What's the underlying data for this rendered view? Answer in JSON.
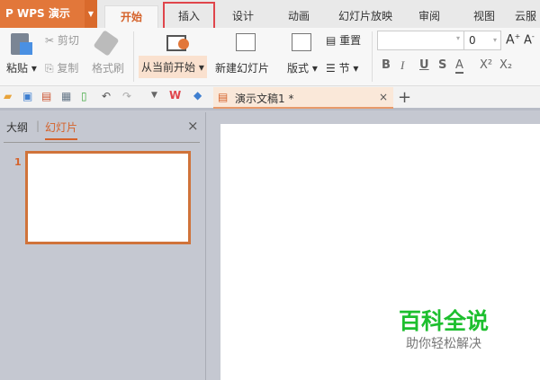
{
  "app": {
    "title": "WPS 演示",
    "tabs": [
      "开始",
      "插入",
      "设计",
      "动画",
      "幻灯片放映",
      "审阅",
      "视图",
      "云服"
    ],
    "active_tab": "开始",
    "highlighted_tab": "插入"
  },
  "ribbon": {
    "paste": "粘贴",
    "cut": "剪切",
    "copy": "复制",
    "format_painter": "格式刷",
    "play_from_current": "从当前开始",
    "new_slide": "新建幻灯片",
    "layout": "版式",
    "reset": "重置",
    "section": "节",
    "font_size": "0",
    "format_buttons": [
      "B",
      "I",
      "U",
      "S",
      "A",
      "X²",
      "X₂"
    ]
  },
  "document_tab": {
    "title": "演示文稿1 *"
  },
  "panel": {
    "tab_outline": "大纲",
    "tab_slides": "幻灯片",
    "slide_number": "1"
  },
  "watermark": {
    "title": "百科全说",
    "subtitle": "助你轻松解决"
  },
  "colors": {
    "accent": "#e2773a",
    "highlight": "#e0454b",
    "watermark": "#1dbf2e"
  }
}
